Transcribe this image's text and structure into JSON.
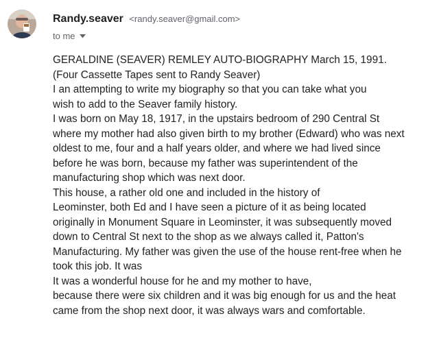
{
  "sender": {
    "name": "Randy.seaver",
    "email": "<randy.seaver@gmail.com>",
    "avatar_icon": "user-photo-avatar"
  },
  "recipient": {
    "label": "to me",
    "dropdown_icon": "caret-down-icon"
  },
  "email_body": {
    "lines": [
      "GERALDINE (SEAVER) REMLEY AUTO-BIOGRAPHY March 15, 1991.",
      "(Four Cassette Tapes sent to Randy Seaver)",
      "I an attempting to write my biography so that you can take what you",
      "wish to add to the Seaver family history.",
      "I was born on May 18, 1917, in the upstairs bedroom of 290 Central St",
      "where my mother had also given birth to my brother (Edward) who was next",
      "oldest to me, four and a half years older, and where we had lived since",
      "before he was born, because my father was superintendent of the",
      "manufacturing shop which was next door.",
      "This house, a rather old one and included in the history of",
      "Leominster, both Ed and I have seen a picture of it as being located",
      "originally in Monument Square in Leominster, it was subsequently moved",
      "down to Central St next to the shop as we always called it, Patton's",
      "Manufacturing. My father was given the use of the house rent-free when he",
      "took this job. It was",
      "It was a wonderful house for he and my mother to have,",
      "because there were six children and it was big enough for us and the heat",
      "came from the shop next door, it was always wars and comfortable."
    ]
  },
  "colors": {
    "text": "#222222",
    "secondary_text": "#5f6368",
    "background": "#ffffff"
  }
}
